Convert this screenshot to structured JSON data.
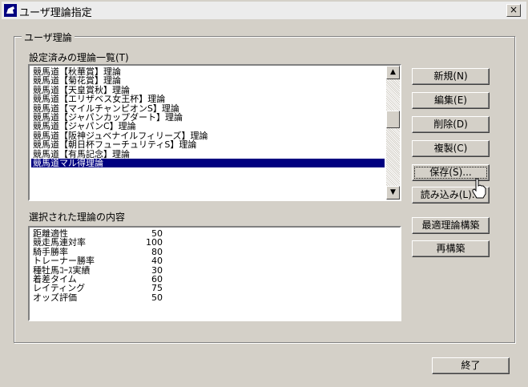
{
  "window": {
    "title": "ユーザ理論指定",
    "close_glyph": "×"
  },
  "group": {
    "legend": "ユーザ理論"
  },
  "theory_list": {
    "label": "設定済みの理論一覧(T)",
    "items": [
      "競馬道【秋華賞】理論",
      "競馬道【菊花賞】理論",
      "競馬道【天皇賞秋】理論",
      "競馬道【エリザベス女王杯】理論",
      "競馬道【マイルチャンピオンS】理論",
      "競馬道【ジャパンカップダート】理論",
      "競馬道【ジャパンC】理論",
      "競馬道【阪神ジュベナイルフィリーズ】理論",
      "競馬道【朝日杯フューチュリティS】理論",
      "競馬道【有馬記念】理論",
      "競馬道マル得理論"
    ],
    "selected_index": 10
  },
  "content": {
    "label": "選択された理論の内容",
    "rows": [
      {
        "k": "距離適性",
        "v": "50"
      },
      {
        "k": "競走馬連対率",
        "v": "100"
      },
      {
        "k": "騎手勝率",
        "v": "80"
      },
      {
        "k": "トレーナー勝率",
        "v": "40"
      },
      {
        "k": "種牡馬ｺｰｽ実績",
        "v": "30"
      },
      {
        "k": "着差タイム",
        "v": "60"
      },
      {
        "k": "レイティング",
        "v": "75"
      },
      {
        "k": "オッズ評価",
        "v": "50"
      }
    ]
  },
  "buttons": {
    "new": "新規(N)",
    "edit": "編集(E)",
    "delete": "削除(D)",
    "copy": "複製(C)",
    "save": "保存(S)...",
    "load": "読み込み(L)...",
    "optimize": "最適理論構築",
    "rebuild": "再構築",
    "exit": "終了"
  },
  "icons": {
    "scroll_up": "▲",
    "scroll_down": "▼"
  }
}
